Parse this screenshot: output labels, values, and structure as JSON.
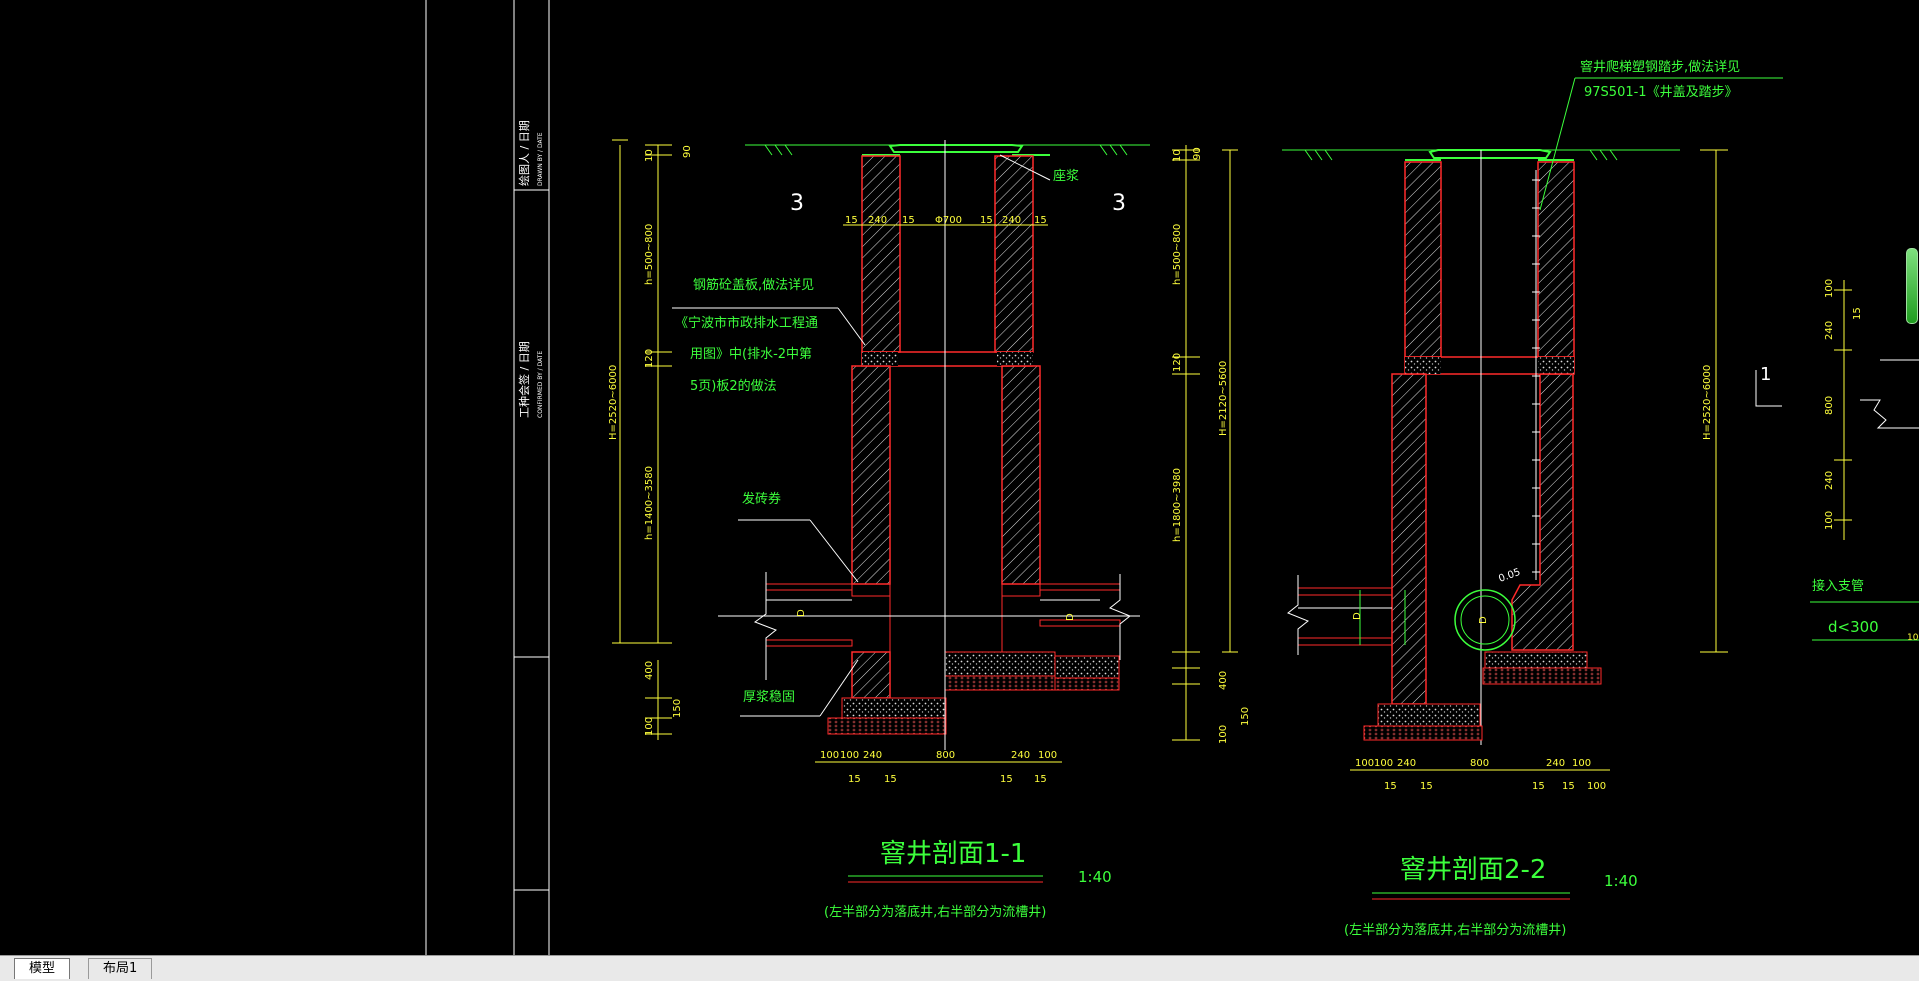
{
  "tabs": [
    {
      "label": "模型",
      "active": true
    },
    {
      "label": "布局1",
      "active": false
    }
  ],
  "title_block": {
    "drawn_by": "绘图人 / 日期",
    "drawn_by_en": "DRAWN BY / DATE",
    "confirmed_by": "工种会签 / 日期",
    "confirmed_by_en": "CONFIRMED BY / DATE"
  },
  "section1": {
    "title": "窨井剖面1-1",
    "scale": "1:40",
    "note": "(左半部分为落底井,右半部分为流槽井)",
    "label_zuojiang": "座浆",
    "label_cover_1": "钢筋砼盖板,做法详见",
    "label_cover_2": "《宁波市市政排水工程通",
    "label_cover_3": "用图》中(排水-2中第",
    "label_cover_4": "5页)板2的做法",
    "label_brick_arch": "发砖券",
    "label_mortar": "厚浆稳固",
    "dim_total": "H=2520~6000",
    "dim_top": "h=500~800",
    "dim_mid": "h=1400~3580",
    "dim_120": "120",
    "dim_10": "10",
    "dim_90": "90",
    "dim_400": "400",
    "dim_150": "150",
    "dim_100": "100",
    "dim_phi700": "Φ700",
    "dim_15": "15",
    "dim_240": "240",
    "dim_800": "800",
    "pipe_d": "D"
  },
  "section2": {
    "title": "窨井剖面2-2",
    "scale": "1:40",
    "note": "(左半部分为落底井,右半部分为流槽井)",
    "label_steps_1": "窨井爬梯塑钢踏步,做法详见",
    "label_steps_2": "97S501-1《井盖及踏步》",
    "dim_total": "H=2520~6000",
    "dim_mid": "H=2120~5600",
    "dim_top": "h=500~800",
    "dim_lower": "h=1800~3980",
    "slope": "0.05",
    "pipe_d": "D",
    "dim_10": "10",
    "dim_90": "90",
    "dim_120": "120",
    "dim_400": "400",
    "dim_150": "150",
    "dim_100": "100",
    "dim_240": "240",
    "dim_800": "800",
    "dim_15": "15",
    "section_marker": "1"
  },
  "right_detail": {
    "label_branch": "接入支管",
    "label_d": "d<300",
    "dim_100": "100",
    "dim_15": "15",
    "dim_240": "240",
    "dim_800": "800",
    "dim_10": "10"
  },
  "colors": {
    "background": "#000000",
    "wall": "#ff2a2a",
    "dim": "#ffff3c",
    "annotation": "#3cff3c",
    "line": "#ffffff",
    "tabbar": "#e9e9e9"
  }
}
